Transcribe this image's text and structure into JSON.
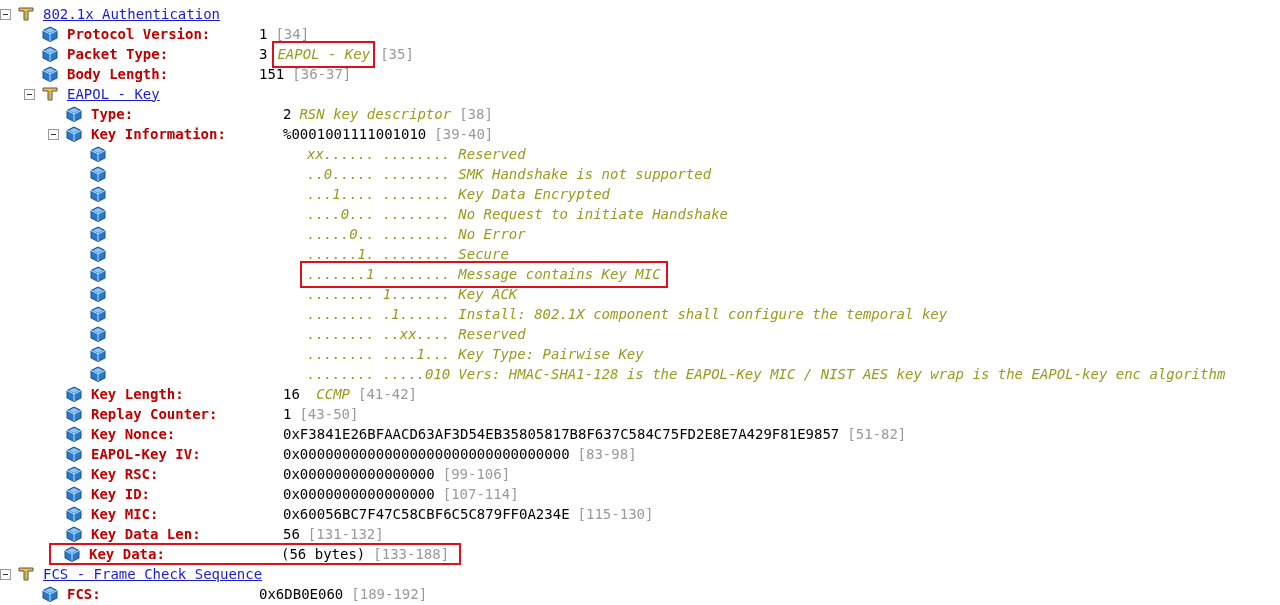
{
  "tree": [
    {
      "kind": "group",
      "label": "802.1x Authentication",
      "expanded": true,
      "children": [
        {
          "kind": "field",
          "label": "Protocol Version:",
          "value": "1",
          "range": "[34]"
        },
        {
          "kind": "field",
          "label": "Packet Type:",
          "value": "3",
          "comment": "EAPOL - Key",
          "range": "[35]",
          "comment_highlighted": true
        },
        {
          "kind": "field",
          "label": "Body Length:",
          "value": "151",
          "range": "[36-37]"
        },
        {
          "kind": "group",
          "label": "EAPOL - Key",
          "expanded": true,
          "children": [
            {
              "kind": "field",
              "label": "Type:",
              "value": "2",
              "comment": "RSN key descriptor",
              "range": "[38]"
            },
            {
              "kind": "field",
              "label": "Key Information:",
              "value": "%0001001111001010",
              "range": "[39-40]",
              "expanded": true,
              "children": [
                {
                  "kind": "bits",
                  "value": "xx...... ........",
                  "comment": "Reserved"
                },
                {
                  "kind": "bits",
                  "value": "..0..... ........",
                  "comment": "SMK Handshake is not supported"
                },
                {
                  "kind": "bits",
                  "value": "...1.... ........",
                  "comment": "Key Data Encrypted"
                },
                {
                  "kind": "bits",
                  "value": "....0... ........",
                  "comment": "No Request to initiate Handshake"
                },
                {
                  "kind": "bits",
                  "value": ".....0.. ........",
                  "comment": "No Error"
                },
                {
                  "kind": "bits",
                  "value": "......1. ........",
                  "comment": "Secure"
                },
                {
                  "kind": "bits",
                  "value": ".......1 ........",
                  "comment": "Message contains Key MIC",
                  "highlighted": true
                },
                {
                  "kind": "bits",
                  "value": "........ 1.......",
                  "comment": "Key ACK"
                },
                {
                  "kind": "bits",
                  "value": "........ .1......",
                  "comment": "Install: 802.1X component shall configure the temporal key"
                },
                {
                  "kind": "bits",
                  "value": "........ ..xx....",
                  "comment": "Reserved"
                },
                {
                  "kind": "bits",
                  "value": "........ ....1...",
                  "comment": "Key Type: Pairwise Key"
                },
                {
                  "kind": "bits",
                  "value": "........ .....010",
                  "comment": "Vers: HMAC-SHA1-128 is the EAPOL-Key MIC / NIST AES key wrap is the EAPOL-key enc algorithm"
                }
              ]
            },
            {
              "kind": "field",
              "label": "Key Length:",
              "value": "16 ",
              "comment": "CCMP",
              "range": "[41-42]"
            },
            {
              "kind": "field",
              "label": "Replay Counter:",
              "value": "1",
              "range": "[43-50]"
            },
            {
              "kind": "field",
              "label": "Key Nonce:",
              "value": "0xF3841E26BFAACD63AF3D54EB35805817B8F637C584C75FD2E8E7A429F81E9857",
              "range": "[51-82]"
            },
            {
              "kind": "field",
              "label": "EAPOL-Key IV:",
              "value": "0x00000000000000000000000000000000",
              "range": "[83-98]"
            },
            {
              "kind": "field",
              "label": "Key RSC:",
              "value": "0x0000000000000000",
              "range": "[99-106]"
            },
            {
              "kind": "field",
              "label": "Key ID:",
              "value": "0x0000000000000000",
              "range": "[107-114]"
            },
            {
              "kind": "field",
              "label": "Key MIC:",
              "value": "0x60056BC7F47C58CBF6C5C879FF0A234E",
              "range": "[115-130]"
            },
            {
              "kind": "field",
              "label": "Key Data Len:",
              "value": "56",
              "range": "[131-132]"
            },
            {
              "kind": "field",
              "label": "Key Data:",
              "value": "(56 bytes)",
              "range": "[133-188]",
              "highlighted": true
            }
          ]
        }
      ]
    },
    {
      "kind": "group",
      "label": "FCS - Frame Check Sequence",
      "expanded": true,
      "children": [
        {
          "kind": "field",
          "label": "FCS:",
          "value": "0x6DB0E060",
          "range": "[189-192]"
        }
      ]
    }
  ]
}
